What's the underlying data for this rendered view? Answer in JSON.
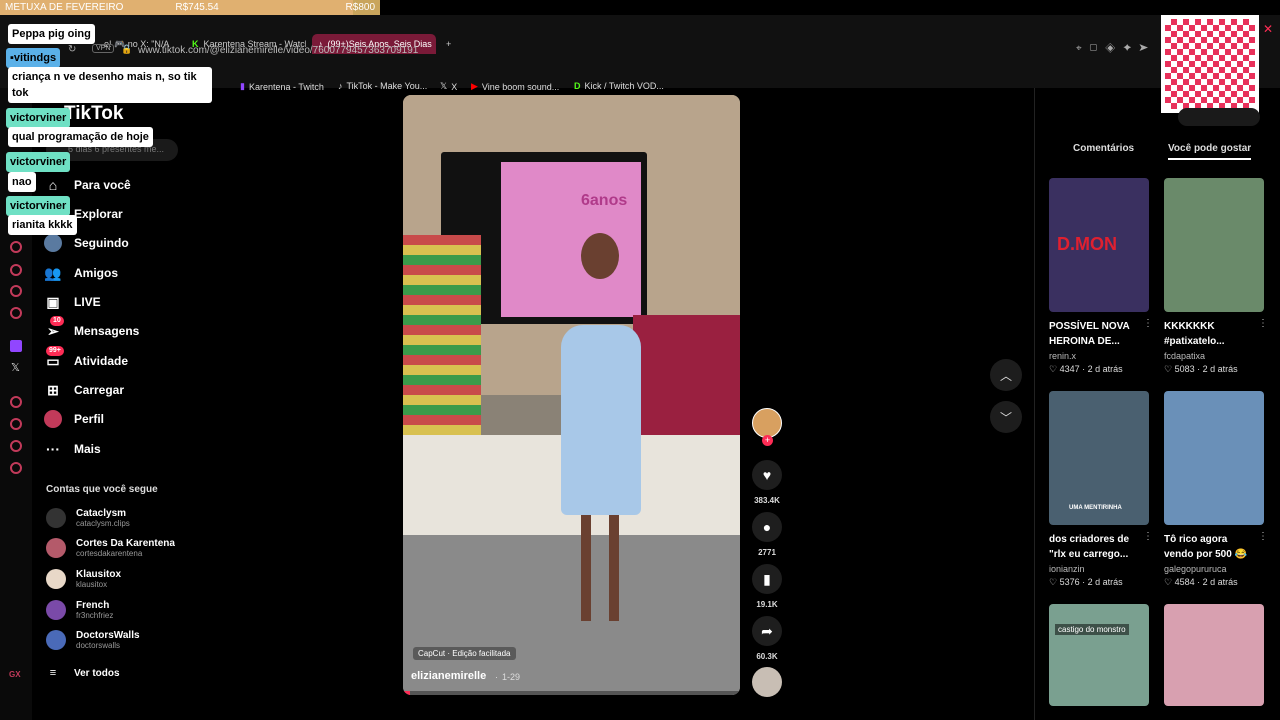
{
  "overlay": {
    "goal_title": "METUXA DE FEVEREIRO",
    "goal_current": "R$745.54",
    "goal_target": "R$800",
    "goal_progress": 0.93
  },
  "browser": {
    "tabs": [
      {
        "label": "e! 🎮 no X: \"N/A"
      },
      {
        "label": "Karentena Stream - Watch"
      },
      {
        "label": "(99+)Seis Anos, Seis Dias"
      }
    ],
    "url": "www.tiktok.com/@elizianemirelle/video/7600779457363709191",
    "vpn_label": "VPN",
    "bookmarks": [
      "Karentena - Twitch",
      "TikTok - Make You...",
      "X",
      "Vine boom sound...",
      "Kick / Twitch VOD..."
    ]
  },
  "chat": [
    {
      "type": "msg",
      "text": "Peppa pig oing"
    },
    {
      "type": "user",
      "text": "vitindgs"
    },
    {
      "type": "msg",
      "text": "criança n ve desenho mais n, so tik tok"
    },
    {
      "type": "user",
      "text": "victorviner"
    },
    {
      "type": "msg",
      "text": "qual programação de hoje"
    },
    {
      "type": "user",
      "text": "victorviner"
    },
    {
      "type": "msg",
      "text": "nao"
    },
    {
      "type": "user",
      "text": "victorviner"
    },
    {
      "type": "msg",
      "text": "rianita kkkk"
    }
  ],
  "tiktok": {
    "logo": "TikTok",
    "search_placeholder": "6 dias 6 presentes me...",
    "nav": [
      {
        "label": "Para você",
        "icon": "home-icon"
      },
      {
        "label": "Explorar",
        "icon": "compass-icon"
      },
      {
        "label": "Seguindo",
        "icon": "following-avatar-icon"
      },
      {
        "label": "Amigos",
        "icon": "friends-icon"
      },
      {
        "label": "LIVE",
        "icon": "live-icon"
      },
      {
        "label": "Mensagens",
        "icon": "messages-icon",
        "badge": "10"
      },
      {
        "label": "Atividade",
        "icon": "activity-icon",
        "badge": "99+"
      },
      {
        "label": "Carregar",
        "icon": "upload-icon"
      },
      {
        "label": "Perfil",
        "icon": "profile-icon"
      },
      {
        "label": "Mais",
        "icon": "more-icon"
      }
    ],
    "following_title": "Contas que você segue",
    "following": [
      {
        "name": "Cataclysm",
        "handle": "cataclysm.clips",
        "color": "#333333"
      },
      {
        "name": "Cortes Da Karentena",
        "handle": "cortesdakarentena",
        "color": "#b45a6a"
      },
      {
        "name": "Klausitox",
        "handle": "klausitox",
        "color": "#e8d8c8"
      },
      {
        "name": "French",
        "handle": "fr3nchfriez",
        "color": "#7a4aa8"
      },
      {
        "name": "DoctorsWalls",
        "handle": "doctorswalls",
        "color": "#4a6ab8"
      }
    ],
    "see_all": "Ver todos"
  },
  "video": {
    "capcut_label": "CapCut · Edição facilitada",
    "author": "elizianemirelle",
    "date": "1-29",
    "tv_text": "6anos",
    "progress": 0.02
  },
  "actions": [
    {
      "icon": "heart-icon",
      "count": "383.4K"
    },
    {
      "icon": "comment-icon",
      "count": "2771"
    },
    {
      "icon": "bookmark-icon",
      "count": "19.1K"
    },
    {
      "icon": "share-icon",
      "count": "60.3K"
    }
  ],
  "right": {
    "tabs": [
      "Comentários",
      "Você pode gostar"
    ],
    "cards": [
      {
        "title": "POSSÍVEL NOVA HEROINA DE...",
        "author": "renin.x",
        "likes": "4347",
        "age": "2 d atrás",
        "thumb_text": "D.MON",
        "bg": "#3a3060"
      },
      {
        "title": "KKKKKKK #patixatelo...",
        "author": "fcdapatixa",
        "likes": "5083",
        "age": "2 d atrás",
        "thumb_text": "",
        "bg": "#6a8a6a"
      },
      {
        "title": "dos criadores de \"rlx eu carrego...",
        "author": "ionianzin",
        "likes": "5376",
        "age": "2 d atrás",
        "thumb_text": "UMA MENTIRINHA",
        "bg": "#4a6070"
      },
      {
        "title": "Tô rico agora vendo por 500 😂",
        "author": "galegopururuca",
        "likes": "4584",
        "age": "2 d atrás",
        "thumb_text": "",
        "bg": "#6a90b8"
      },
      {
        "title": "",
        "author": "",
        "likes": "",
        "age": "",
        "thumb_text": "castigo do monstro",
        "bg": "#7aa090"
      },
      {
        "title": "",
        "author": "",
        "likes": "",
        "age": "",
        "thumb_text": "",
        "bg": "#d8a0b0"
      }
    ]
  }
}
